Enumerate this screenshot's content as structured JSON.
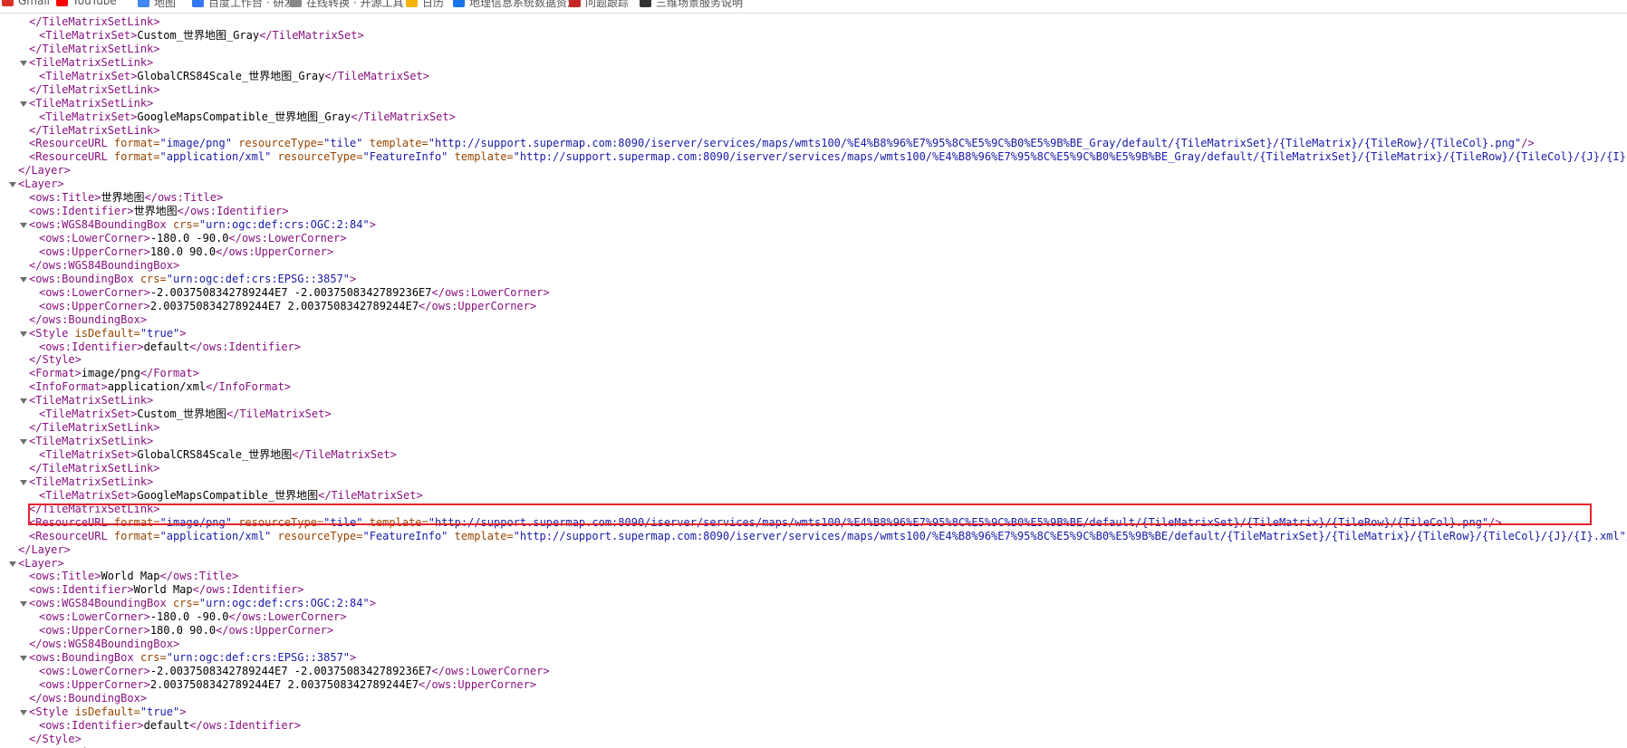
{
  "bookmarks": [
    {
      "label": "Gmail",
      "color": "#d93025"
    },
    {
      "label": "YouTube",
      "color": "#ff0000"
    },
    {
      "label": "地图",
      "color": "#4285f4"
    },
    {
      "label": "百度工作台 · 研发",
      "color": "#3478f6"
    },
    {
      "label": "在线转换 · 开源工具",
      "color": "#888888"
    },
    {
      "label": "日历",
      "color": "#f4b400"
    },
    {
      "label": "地理信息系统数据资源",
      "color": "#1a73e8"
    },
    {
      "label": "问题跟踪",
      "color": "#c62828"
    },
    {
      "label": "三维场景服务说明",
      "color": "#333333"
    }
  ],
  "xml_lines": [
    {
      "i": 2,
      "p": [
        [
          "t",
          "</TileMatrixSetLink>"
        ]
      ]
    },
    {
      "i": 3,
      "p": [
        [
          "t",
          "<TileMatrixSet>"
        ],
        [
          "x",
          "Custom_世界地图_Gray"
        ],
        [
          "t",
          "</TileMatrixSet>"
        ]
      ]
    },
    {
      "i": 2,
      "p": [
        [
          "t",
          "</TileMatrixSetLink>"
        ]
      ]
    },
    {
      "i": 2,
      "tri": true,
      "p": [
        [
          "t",
          "<TileMatrixSetLink>"
        ]
      ]
    },
    {
      "i": 3,
      "p": [
        [
          "t",
          "<TileMatrixSet>"
        ],
        [
          "x",
          "GlobalCRS84Scale_世界地图_Gray"
        ],
        [
          "t",
          "</TileMatrixSet>"
        ]
      ]
    },
    {
      "i": 2,
      "p": [
        [
          "t",
          "</TileMatrixSetLink>"
        ]
      ]
    },
    {
      "i": 2,
      "tri": true,
      "p": [
        [
          "t",
          "<TileMatrixSetLink>"
        ]
      ]
    },
    {
      "i": 3,
      "p": [
        [
          "t",
          "<TileMatrixSet>"
        ],
        [
          "x",
          "GoogleMapsCompatible_世界地图_Gray"
        ],
        [
          "t",
          "</TileMatrixSet>"
        ]
      ]
    },
    {
      "i": 2,
      "p": [
        [
          "t",
          "</TileMatrixSetLink>"
        ]
      ]
    },
    {
      "i": 2,
      "p": [
        [
          "t",
          "<ResourceURL "
        ],
        [
          "a",
          "format="
        ],
        [
          "v",
          "\"image/png\""
        ],
        [
          "a",
          " resourceType="
        ],
        [
          "v",
          "\"tile\""
        ],
        [
          "a",
          " template="
        ],
        [
          "v",
          "\"http://support.supermap.com:8090/iserver/services/maps/wmts100/%E4%B8%96%E7%95%8C%E5%9C%B0%E5%9B%BE_Gray/default/{TileMatrixSet}/{TileMatrix}/{TileRow}/{TileCol}.png\""
        ],
        [
          "t",
          "/>"
        ]
      ]
    },
    {
      "i": 2,
      "p": [
        [
          "t",
          "<ResourceURL "
        ],
        [
          "a",
          "format="
        ],
        [
          "v",
          "\"application/xml\""
        ],
        [
          "a",
          " resourceType="
        ],
        [
          "v",
          "\"FeatureInfo\""
        ],
        [
          "a",
          " template="
        ],
        [
          "v",
          "\"http://support.supermap.com:8090/iserver/services/maps/wmts100/%E4%B8%96%E7%95%8C%E5%9C%B0%E5%9B%BE_Gray/default/{TileMatrixSet}/{TileMatrix}/{TileRow}/{TileCol}/{J}/{I}.xml\""
        ],
        [
          "t",
          "/>"
        ]
      ]
    },
    {
      "i": 1,
      "p": [
        [
          "t",
          "</Layer>"
        ]
      ]
    },
    {
      "i": 1,
      "tri": true,
      "p": [
        [
          "t",
          "<Layer>"
        ]
      ]
    },
    {
      "i": 2,
      "p": [
        [
          "t",
          "<ows:Title>"
        ],
        [
          "x",
          "世界地图"
        ],
        [
          "t",
          "</ows:Title>"
        ]
      ]
    },
    {
      "i": 2,
      "p": [
        [
          "t",
          "<ows:Identifier>"
        ],
        [
          "x",
          "世界地图"
        ],
        [
          "t",
          "</ows:Identifier>"
        ]
      ]
    },
    {
      "i": 2,
      "tri": true,
      "p": [
        [
          "t",
          "<ows:WGS84BoundingBox "
        ],
        [
          "a",
          "crs="
        ],
        [
          "v",
          "\"urn:ogc:def:crs:OGC:2:84\""
        ],
        [
          "t",
          ">"
        ]
      ]
    },
    {
      "i": 3,
      "p": [
        [
          "t",
          "<ows:LowerCorner>"
        ],
        [
          "x",
          "-180.0 -90.0"
        ],
        [
          "t",
          "</ows:LowerCorner>"
        ]
      ]
    },
    {
      "i": 3,
      "p": [
        [
          "t",
          "<ows:UpperCorner>"
        ],
        [
          "x",
          "180.0 90.0"
        ],
        [
          "t",
          "</ows:UpperCorner>"
        ]
      ]
    },
    {
      "i": 2,
      "p": [
        [
          "t",
          "</ows:WGS84BoundingBox>"
        ]
      ]
    },
    {
      "i": 2,
      "tri": true,
      "p": [
        [
          "t",
          "<ows:BoundingBox "
        ],
        [
          "a",
          "crs="
        ],
        [
          "v",
          "\"urn:ogc:def:crs:EPSG::3857\""
        ],
        [
          "t",
          ">"
        ]
      ]
    },
    {
      "i": 3,
      "p": [
        [
          "t",
          "<ows:LowerCorner>"
        ],
        [
          "x",
          "-2.0037508342789244E7 -2.0037508342789236E7"
        ],
        [
          "t",
          "</ows:LowerCorner>"
        ]
      ]
    },
    {
      "i": 3,
      "p": [
        [
          "t",
          "<ows:UpperCorner>"
        ],
        [
          "x",
          "2.0037508342789244E7 2.0037508342789244E7"
        ],
        [
          "t",
          "</ows:UpperCorner>"
        ]
      ]
    },
    {
      "i": 2,
      "p": [
        [
          "t",
          "</ows:BoundingBox>"
        ]
      ]
    },
    {
      "i": 2,
      "tri": true,
      "p": [
        [
          "t",
          "<Style "
        ],
        [
          "a",
          "isDefault="
        ],
        [
          "v",
          "\"true\""
        ],
        [
          "t",
          ">"
        ]
      ]
    },
    {
      "i": 3,
      "p": [
        [
          "t",
          "<ows:Identifier>"
        ],
        [
          "x",
          "default"
        ],
        [
          "t",
          "</ows:Identifier>"
        ]
      ]
    },
    {
      "i": 2,
      "p": [
        [
          "t",
          "</Style>"
        ]
      ]
    },
    {
      "i": 2,
      "p": [
        [
          "t",
          "<Format>"
        ],
        [
          "x",
          "image/png"
        ],
        [
          "t",
          "</Format>"
        ]
      ]
    },
    {
      "i": 2,
      "p": [
        [
          "t",
          "<InfoFormat>"
        ],
        [
          "x",
          "application/xml"
        ],
        [
          "t",
          "</InfoFormat>"
        ]
      ]
    },
    {
      "i": 2,
      "tri": true,
      "p": [
        [
          "t",
          "<TileMatrixSetLink>"
        ]
      ]
    },
    {
      "i": 3,
      "p": [
        [
          "t",
          "<TileMatrixSet>"
        ],
        [
          "x",
          "Custom_世界地图"
        ],
        [
          "t",
          "</TileMatrixSet>"
        ]
      ]
    },
    {
      "i": 2,
      "p": [
        [
          "t",
          "</TileMatrixSetLink>"
        ]
      ]
    },
    {
      "i": 2,
      "tri": true,
      "p": [
        [
          "t",
          "<TileMatrixSetLink>"
        ]
      ]
    },
    {
      "i": 3,
      "p": [
        [
          "t",
          "<TileMatrixSet>"
        ],
        [
          "x",
          "GlobalCRS84Scale_世界地图"
        ],
        [
          "t",
          "</TileMatrixSet>"
        ]
      ]
    },
    {
      "i": 2,
      "p": [
        [
          "t",
          "</TileMatrixSetLink>"
        ]
      ]
    },
    {
      "i": 2,
      "tri": true,
      "p": [
        [
          "t",
          "<TileMatrixSetLink>"
        ]
      ]
    },
    {
      "i": 3,
      "p": [
        [
          "t",
          "<TileMatrixSet>"
        ],
        [
          "x",
          "GoogleMapsCompatible_世界地图"
        ],
        [
          "t",
          "</TileMatrixSet>"
        ]
      ]
    },
    {
      "i": 2,
      "p": [
        [
          "t",
          "</TileMatrixSetLink>"
        ]
      ]
    },
    {
      "i": 2,
      "p": [
        [
          "t",
          "<ResourceURL "
        ],
        [
          "a",
          "format="
        ],
        [
          "v",
          "\"image/png\""
        ],
        [
          "a",
          " resourceType="
        ],
        [
          "v",
          "\"tile\""
        ],
        [
          "a",
          " template="
        ],
        [
          "v",
          "\"http://support.supermap.com:8090/iserver/services/maps/wmts100/%E4%B8%96%E7%95%8C%E5%9C%B0%E5%9B%BE/default/{TileMatrixSet}/{TileMatrix}/{TileRow}/{TileCol}.png\""
        ],
        [
          "t",
          "/>"
        ]
      ]
    },
    {
      "i": 2,
      "p": [
        [
          "t",
          "<ResourceURL "
        ],
        [
          "a",
          "format="
        ],
        [
          "v",
          "\"application/xml\""
        ],
        [
          "a",
          " resourceType="
        ],
        [
          "v",
          "\"FeatureInfo\""
        ],
        [
          "a",
          " template="
        ],
        [
          "v",
          "\"http://support.supermap.com:8090/iserver/services/maps/wmts100/%E4%B8%96%E7%95%8C%E5%9C%B0%E5%9B%BE/default/{TileMatrixSet}/{TileMatrix}/{TileRow}/{TileCol}/{J}/{I}.xml\""
        ],
        [
          "t",
          "/>"
        ]
      ]
    },
    {
      "i": 1,
      "p": [
        [
          "t",
          "</Layer>"
        ]
      ]
    },
    {
      "i": 1,
      "tri": true,
      "p": [
        [
          "t",
          "<Layer>"
        ]
      ]
    },
    {
      "i": 2,
      "p": [
        [
          "t",
          "<ows:Title>"
        ],
        [
          "x",
          "World Map"
        ],
        [
          "t",
          "</ows:Title>"
        ]
      ]
    },
    {
      "i": 2,
      "p": [
        [
          "t",
          "<ows:Identifier>"
        ],
        [
          "x",
          "World Map"
        ],
        [
          "t",
          "</ows:Identifier>"
        ]
      ]
    },
    {
      "i": 2,
      "tri": true,
      "p": [
        [
          "t",
          "<ows:WGS84BoundingBox "
        ],
        [
          "a",
          "crs="
        ],
        [
          "v",
          "\"urn:ogc:def:crs:OGC:2:84\""
        ],
        [
          "t",
          ">"
        ]
      ]
    },
    {
      "i": 3,
      "p": [
        [
          "t",
          "<ows:LowerCorner>"
        ],
        [
          "x",
          "-180.0 -90.0"
        ],
        [
          "t",
          "</ows:LowerCorner>"
        ]
      ]
    },
    {
      "i": 3,
      "p": [
        [
          "t",
          "<ows:UpperCorner>"
        ],
        [
          "x",
          "180.0 90.0"
        ],
        [
          "t",
          "</ows:UpperCorner>"
        ]
      ]
    },
    {
      "i": 2,
      "p": [
        [
          "t",
          "</ows:WGS84BoundingBox>"
        ]
      ]
    },
    {
      "i": 2,
      "tri": true,
      "p": [
        [
          "t",
          "<ows:BoundingBox "
        ],
        [
          "a",
          "crs="
        ],
        [
          "v",
          "\"urn:ogc:def:crs:EPSG::3857\""
        ],
        [
          "t",
          ">"
        ]
      ]
    },
    {
      "i": 3,
      "p": [
        [
          "t",
          "<ows:LowerCorner>"
        ],
        [
          "x",
          "-2.0037508342789244E7 -2.0037508342789236E7"
        ],
        [
          "t",
          "</ows:LowerCorner>"
        ]
      ]
    },
    {
      "i": 3,
      "p": [
        [
          "t",
          "<ows:UpperCorner>"
        ],
        [
          "x",
          "2.0037508342789244E7 2.0037508342789244E7"
        ],
        [
          "t",
          "</ows:UpperCorner>"
        ]
      ]
    },
    {
      "i": 2,
      "p": [
        [
          "t",
          "</ows:BoundingBox>"
        ]
      ]
    },
    {
      "i": 2,
      "tri": true,
      "p": [
        [
          "t",
          "<Style "
        ],
        [
          "a",
          "isDefault="
        ],
        [
          "v",
          "\"true\""
        ],
        [
          "t",
          ">"
        ]
      ]
    },
    {
      "i": 3,
      "p": [
        [
          "t",
          "<ows:Identifier>"
        ],
        [
          "x",
          "default"
        ],
        [
          "t",
          "</ows:Identifier>"
        ]
      ]
    },
    {
      "i": 2,
      "p": [
        [
          "t",
          "</Style>"
        ]
      ]
    },
    {
      "i": 2,
      "p": [
        [
          "t",
          "<Format>"
        ],
        [
          "x",
          "image/png"
        ],
        [
          "t",
          "</Format>"
        ]
      ]
    }
  ],
  "highlighted_line": 37,
  "colors": {
    "tag": "#881280",
    "attr_name": "#994500",
    "attr_value": "#1a1aa6",
    "text": "#000000",
    "highlight_box": "#e8232a"
  }
}
